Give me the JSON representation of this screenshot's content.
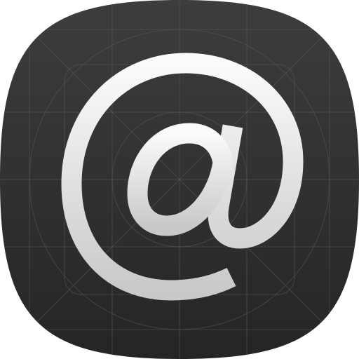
{
  "icon": {
    "name": "at-sign-app-icon",
    "glyph": "at-sign-icon",
    "colors": {
      "background_top": "#3d3d3d",
      "background_bottom": "#252525",
      "glyph_top": "#fbfbfb",
      "glyph_bottom": "#c9c9c9",
      "grid_line": "#5a5a5a"
    }
  }
}
